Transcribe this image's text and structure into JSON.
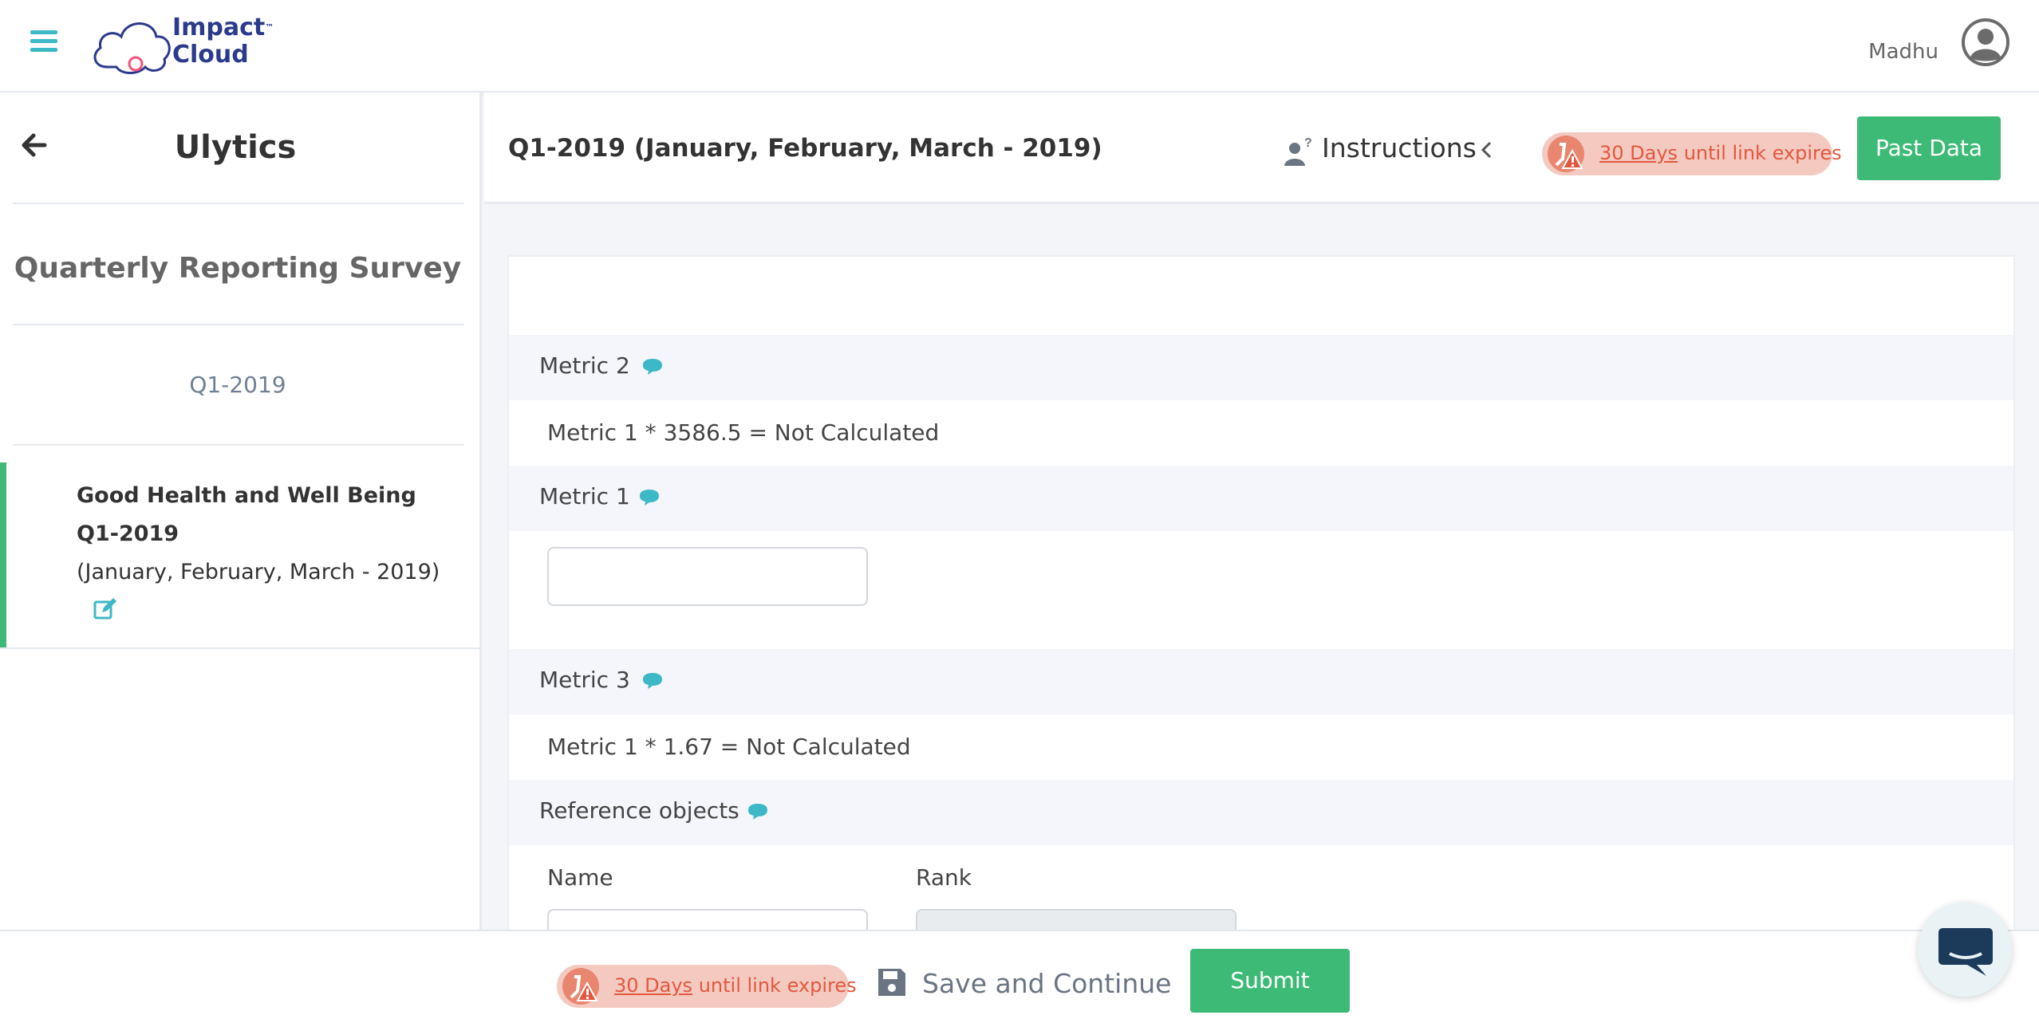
{
  "header": {
    "logo_line1": "Impact",
    "logo_tm": "™",
    "logo_line2": "Cloud",
    "user_name": "Madhu"
  },
  "sidebar": {
    "title": "Ulytics",
    "survey_name": "Quarterly Reporting Survey",
    "period": "Q1-2019",
    "active_item": {
      "line1": "Good Health and Well Being",
      "line2": "Q1-2019",
      "line3": "(January, February, March - 2019)"
    }
  },
  "main": {
    "period_title": "Q1-2019 (January, February, March - 2019)",
    "instructions_label": "Instructions",
    "expire": {
      "days": "30 Days",
      "text": " until link expires"
    },
    "past_data_label": "Past Data",
    "rows": [
      {
        "label": "Metric 2",
        "calc": "Metric 1 * 3586.5 = Not Calculated"
      },
      {
        "label": "Metric 1",
        "value": ""
      },
      {
        "label": "Metric 3",
        "calc": "Metric 1 * 1.67 = Not Calculated"
      },
      {
        "label": "Reference objects",
        "columns": [
          "Name",
          "Rank"
        ]
      }
    ]
  },
  "footer": {
    "expire": {
      "days": "30 Days",
      "text": " until link expires"
    },
    "save_label": "Save and Continue",
    "submit_label": "Submit"
  },
  "colors": {
    "accent_teal": "#3db8c6",
    "brand_navy": "#2b3a8c",
    "success_green": "#3dbb76",
    "warning_red": "#e2583f",
    "warning_bg": "#f4c9c0"
  },
  "icons": [
    "hamburger-icon",
    "user-avatar-icon",
    "back-arrow-icon",
    "edit-icon",
    "instructions-icon",
    "chevron-left-icon",
    "expire-warning-icon",
    "comment-icon",
    "save-icon",
    "chat-icon"
  ]
}
